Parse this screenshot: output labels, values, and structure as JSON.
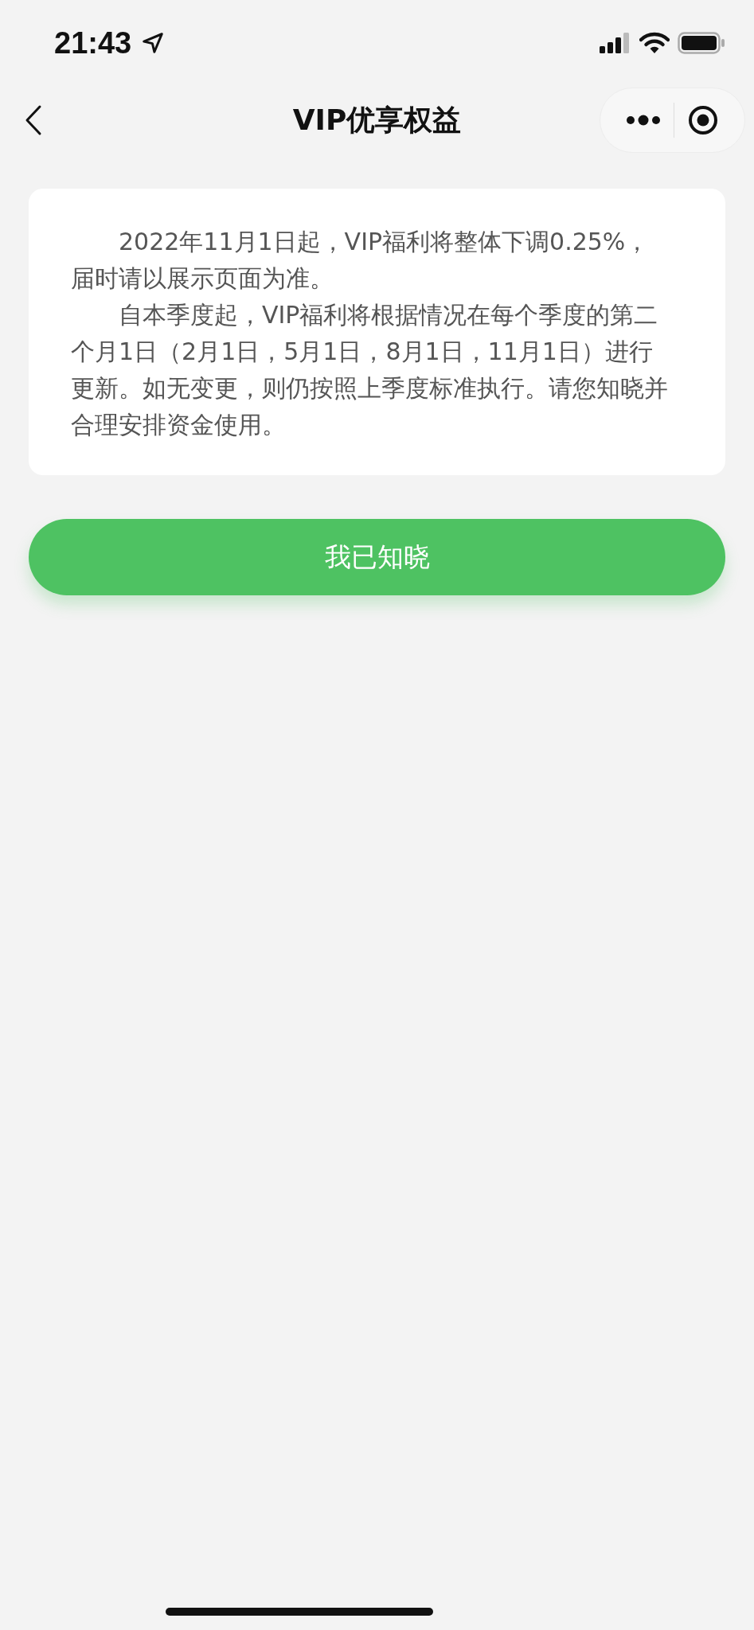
{
  "status_bar": {
    "time": "21:43"
  },
  "nav": {
    "title": "VIP优享权益"
  },
  "notice": {
    "paragraphs": [
      "2022年11月1日起，VIP福利将整体下调0.25%，届时请以展示页面为准。",
      "自本季度起，VIP福利将根据情况在每个季度的第二个月1日（2月1日，5月1日，8月1日，11月1日）进行更新。如无变更，则仍按照上季度标准执行。请您知晓并合理安排资金使用。"
    ]
  },
  "confirm_button": {
    "label": "我已知晓"
  }
}
